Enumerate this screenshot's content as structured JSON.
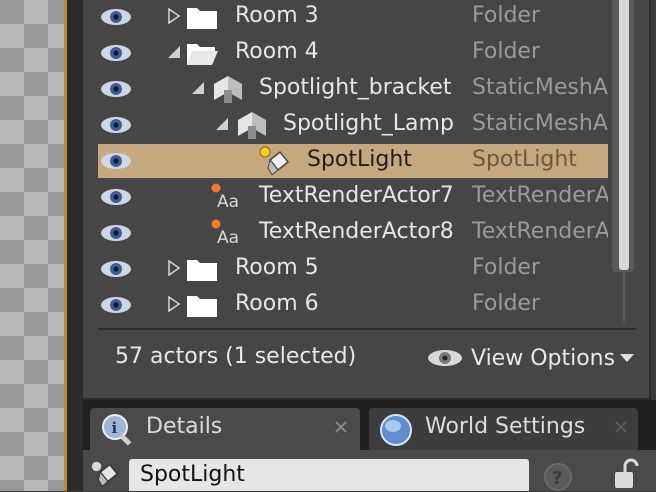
{
  "outliner": {
    "rows": [
      {
        "name": "Room 3",
        "type": "Folder",
        "kind": "folder-icon",
        "expanded": false
      },
      {
        "name": "Room 4",
        "type": "Folder",
        "kind": "folder-icon",
        "expanded": true
      },
      {
        "name": "Spotlight_bracket",
        "type": "StaticMeshA",
        "kind": "static-mesh-icon",
        "expanded": true
      },
      {
        "name": "Spotlight_Lamp",
        "type": "StaticMeshA",
        "kind": "static-mesh-icon",
        "expanded": true
      },
      {
        "name": "SpotLight",
        "type": "SpotLight",
        "kind": "spotlight-icon",
        "selected": true
      },
      {
        "name": "TextRenderActor7",
        "type": "TextRenderA",
        "kind": "text-render-icon"
      },
      {
        "name": "TextRenderActor8",
        "type": "TextRenderA",
        "kind": "text-render-icon"
      },
      {
        "name": "Room 5",
        "type": "Folder",
        "kind": "folder-icon",
        "expanded": false
      },
      {
        "name": "Room 6",
        "type": "Folder",
        "kind": "folder-icon",
        "expanded": false
      }
    ],
    "status": "57 actors (1 selected)",
    "view_options_label": "View Options"
  },
  "tabs": [
    {
      "label": "Details",
      "icon": "info-icon",
      "active": true
    },
    {
      "label": "World Settings",
      "icon": "globe-icon",
      "active": false
    }
  ],
  "details": {
    "actor_name_value": "SpotLight"
  },
  "colors": {
    "selection": "#c7a87e",
    "panel": "#464646",
    "viewport_border": "#c08a2a"
  }
}
